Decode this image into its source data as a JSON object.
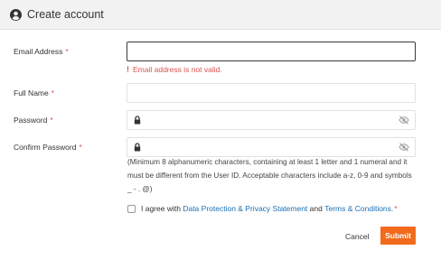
{
  "header": {
    "title": "Create account",
    "icon": "user-circle-icon"
  },
  "form": {
    "email": {
      "label": "Email Address",
      "required_mark": "*",
      "value": "",
      "error": "Email address is not valid.",
      "error_mark": "!"
    },
    "full_name": {
      "label": "Full Name",
      "required_mark": "*",
      "value": ""
    },
    "password": {
      "label": "Password",
      "required_mark": "*",
      "value": ""
    },
    "confirm_password": {
      "label": "Confirm Password",
      "required_mark": "*",
      "value": ""
    },
    "password_hint": "(Minimum 8 alphanumeric characters, containing at least 1 letter and 1 numeral and it must be different from the User ID. Acceptable characters include a-z, 0-9 and symbols _ - . @)",
    "agreement": {
      "prefix": "I agree with",
      "link1": "Data Protection & Privacy Statement",
      "middle": "and",
      "link2": "Terms & Conditions.",
      "required_mark": "*",
      "checked": false
    }
  },
  "actions": {
    "cancel_label": "Cancel",
    "submit_label": "Submit"
  },
  "colors": {
    "accent": "#f26a1b",
    "error": "#d9534f",
    "link": "#1a6fb5",
    "header_bg": "#f2f2f2"
  }
}
